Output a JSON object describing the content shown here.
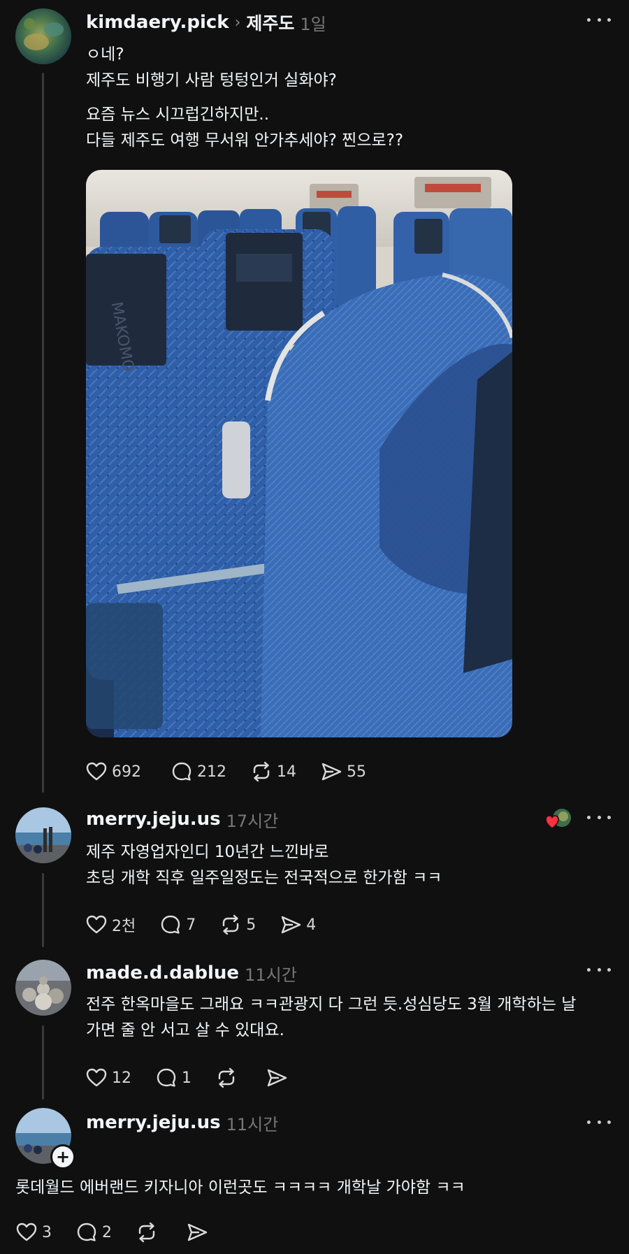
{
  "post": {
    "username": "kimdaery.pick",
    "topic": "제주도",
    "time": "1일",
    "lines": [
      "ㅇ네?",
      "제주도 비행기 사람 텅텅인거 실화야?",
      "요즘 뉴스 시끄럽긴하지만..",
      "다들 제주도 여행 무서워 안가추세야? 찐으로??"
    ],
    "likes": "692",
    "comments": "212",
    "reposts": "14",
    "shares": "55"
  },
  "reply1": {
    "username": "merry.jeju.us",
    "time": "17시간",
    "lines": [
      "제주 자영업자인디 10년간 느낀바로",
      "초딩 개학 직후 일주일정도는 전국적으로 한가함 ㅋㅋ"
    ],
    "likes": "2천",
    "comments": "7",
    "reposts": "5",
    "shares": "4"
  },
  "reply2": {
    "username": "made.d.dablue",
    "time": "11시간",
    "lines": [
      "전주 한옥마을도 그래요 ㅋㅋ관광지 다 그런 듯.성심당도 3월 개학하는 날",
      "가면 줄 안 서고 살 수 있대요."
    ],
    "likes": "12",
    "comments": "1"
  },
  "reply3": {
    "username": "merry.jeju.us",
    "time": "11시간",
    "text": "롯데월드 에버랜드 키자니아 이런곳도 ㅋㅋㅋㅋ 개학날 가야함 ㅋㅋ",
    "likes": "3",
    "comments": "2"
  },
  "icons": {
    "like": "heart-icon",
    "comment": "comment-bubble-icon",
    "repost": "repost-icon",
    "share": "share-send-icon",
    "more": "more-options-icon",
    "follow": "plus-icon"
  },
  "colors": {
    "background": "#101010",
    "text": "#f3f5f7",
    "muted": "#777777",
    "seat_blue": "#2f5fa8",
    "liked_heart": "#ff3040"
  }
}
